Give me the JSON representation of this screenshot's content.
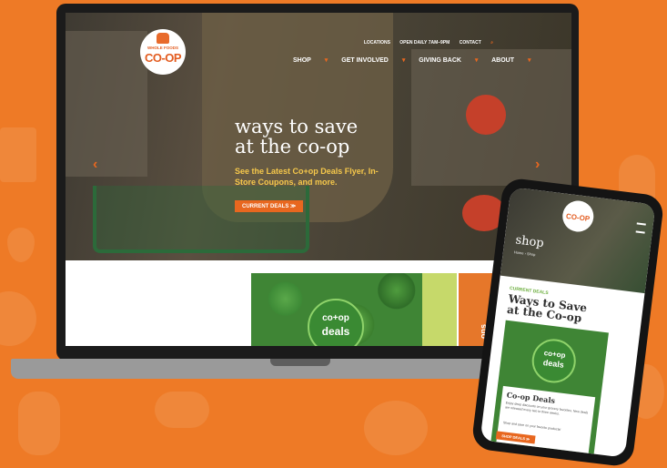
{
  "site": {
    "logo": {
      "line1": "WHOLE FOODS",
      "line2": "CO-OP"
    },
    "utility_nav": [
      "LOCATIONS",
      "OPEN DAILY 7AM–9PM",
      "CONTACT"
    ],
    "main_nav": [
      "SHOP",
      "GET INVOLVED",
      "GIVING BACK",
      "ABOUT"
    ],
    "hero": {
      "title_line1": "ways to save",
      "title_line2": "at the co-op",
      "subtitle": "See the Latest Co+op Deals Flyer, In-Store Coupons, and more.",
      "button": "CURRENT DEALS ≫"
    },
    "promo": {
      "badge_line1": "co+op",
      "badge_line2": "deals",
      "strip_text": "ons"
    }
  },
  "mobile": {
    "logo": "CO-OP",
    "hero_title": "shop",
    "breadcrumb": "Home › Shop",
    "kicker": "CURRENT DEALS",
    "title_line1": "Ways to Save",
    "title_line2": "at the Co-op",
    "badge_line1": "co+op",
    "badge_line2": "deals",
    "card_title": "Co-op Deals",
    "card_body": "Enjoy deep discounts on your grocery favorites. New deals are released every two to three weeks.",
    "card_link": "Shop and save on your favorite products!",
    "button": "SHOP DEALS ≫"
  },
  "colors": {
    "background": "#ee7a26",
    "accent": "#e8671f",
    "green": "#3f8535",
    "yellow": "#f6c84b"
  }
}
